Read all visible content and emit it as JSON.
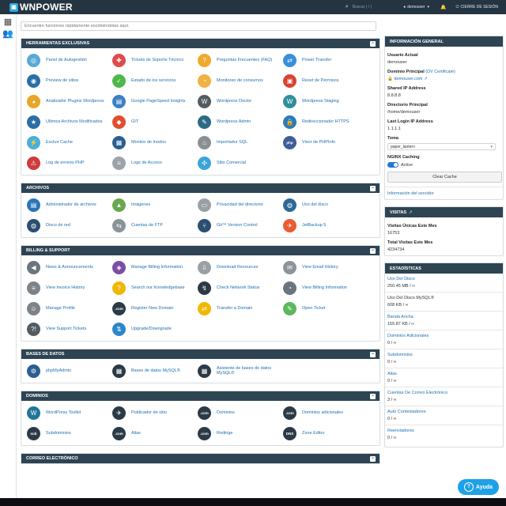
{
  "brand": {
    "name": "WNPOWER"
  },
  "topbar": {
    "search_placeholder": "Buscar ( / )",
    "user": "demouser",
    "logout": "CIERRE DE SESIÓN"
  },
  "main": {
    "search_placeholder": "Encuentre funciones rápidamente escribiéndolas aquí.",
    "panels": [
      {
        "title": "HERRAMIENTAS EXCLUSIVAS",
        "items": [
          {
            "label": "Panel de Autogestión",
            "icon": "dashboard-icon",
            "color": "#5ba9d6",
            "glyph": "◎"
          },
          {
            "label": "Tickets de Soporte Técnico",
            "icon": "lifebuoy-icon",
            "color": "#e04b4b",
            "glyph": "✚"
          },
          {
            "label": "Preguntas Frecuentes (FAQ)",
            "icon": "faq-icon",
            "color": "#f0a92b",
            "glyph": "?"
          },
          {
            "label": "Power Transfer",
            "icon": "power-transfer-icon",
            "color": "#3b8fd9",
            "glyph": "⇄"
          },
          {
            "label": "Preview de sitios",
            "icon": "eye-icon",
            "color": "#2b6fa6",
            "glyph": "◉"
          },
          {
            "label": "Estado de los servicios",
            "icon": "check-icon",
            "color": "#4fb848",
            "glyph": "✓"
          },
          {
            "label": "Monitoreo de consumos",
            "icon": "gauge-icon",
            "color": "#f0b243",
            "glyph": "◔"
          },
          {
            "label": "Reset de Permisos",
            "icon": "lock-icon",
            "color": "#d9442f",
            "glyph": "▣"
          },
          {
            "label": "Analizador Plugins Wordpress",
            "icon": "speedometer-icon",
            "color": "#e8a628",
            "glyph": "◕"
          },
          {
            "label": "Google PageSpeed Insights",
            "icon": "pagespeed-icon",
            "color": "#3d7fc4",
            "glyph": "▤"
          },
          {
            "label": "Wordpress Doctor",
            "icon": "wordpress-doctor-icon",
            "color": "#555b63",
            "glyph": "W"
          },
          {
            "label": "Wordpress Staging",
            "icon": "wordpress-staging-icon",
            "color": "#2f8f9d",
            "glyph": "W"
          },
          {
            "label": "Ultimos Archivos Modificados",
            "icon": "files-recent-icon",
            "color": "#2c6ea3",
            "glyph": "★"
          },
          {
            "label": "GIT",
            "icon": "git-icon",
            "color": "#e04e2f",
            "glyph": "◆"
          },
          {
            "label": "Wordpress Admin",
            "icon": "wordpress-admin-icon",
            "color": "#2e6a86",
            "glyph": "✎"
          },
          {
            "label": "Redireccionador HTTPS",
            "icon": "https-lock-icon",
            "color": "#2d7ab8",
            "glyph": "🔒"
          },
          {
            "label": "Excluir Cache",
            "icon": "cache-icon",
            "color": "#4ab0d9",
            "glyph": "⚡"
          },
          {
            "label": "Monitor de Inodos",
            "icon": "inode-monitor-icon",
            "color": "#2b5e92",
            "glyph": "▦"
          },
          {
            "label": "Importador SQL",
            "icon": "sql-import-icon",
            "color": "#8b8f94",
            "glyph": "⌂"
          },
          {
            "label": "Visor de PHPInfo",
            "icon": "php-icon",
            "color": "#3e5e99",
            "glyph": "php"
          },
          {
            "label": "Log de errores PHP",
            "icon": "error-log-icon",
            "color": "#d03b3b",
            "glyph": "⚠"
          },
          {
            "label": "Logs de Acceso",
            "icon": "access-log-icon",
            "color": "#9da3a8",
            "glyph": "≡"
          },
          {
            "label": "Sitio Comercial",
            "icon": "commercial-site-icon",
            "color": "#3ba5d9",
            "glyph": "✣"
          }
        ]
      },
      {
        "title": "ARCHIVOS",
        "items": [
          {
            "label": "Administrador de archivos",
            "icon": "file-manager-icon",
            "color": "#2c76b8",
            "glyph": "▤"
          },
          {
            "label": "Imágenes",
            "icon": "images-icon",
            "color": "#6aa84f",
            "glyph": "▲"
          },
          {
            "label": "Privacidad del directorio",
            "icon": "folder-privacy-icon",
            "color": "#9aa0a5",
            "glyph": "▭"
          },
          {
            "label": "Uso del disco",
            "icon": "disk-usage-icon",
            "color": "#2e6a96",
            "glyph": "◍"
          },
          {
            "label": "Disco de red",
            "icon": "network-disk-icon",
            "color": "#2b4f72",
            "glyph": "◍"
          },
          {
            "label": "Cuentas de FTP",
            "icon": "ftp-icon",
            "color": "#8c9399",
            "glyph": "⇆"
          },
          {
            "label": "Git™ Version Control",
            "icon": "git-version-icon",
            "color": "#2b4f72",
            "glyph": "⑂"
          },
          {
            "label": "JetBackup 5",
            "icon": "jetbackup-icon",
            "color": "#ea5b2f",
            "glyph": "✈"
          }
        ]
      },
      {
        "title": "BILLING & SUPPORT",
        "items": [
          {
            "label": "News & Announcements",
            "icon": "megaphone-icon",
            "color": "#6c757d",
            "glyph": "◀"
          },
          {
            "label": "Manage Billing Information",
            "icon": "billing-icon",
            "color": "#7a4fa3",
            "glyph": "◈"
          },
          {
            "label": "Download Resources",
            "icon": "download-icon",
            "color": "#9aa0a5",
            "glyph": "⇩"
          },
          {
            "label": "View Email History",
            "icon": "email-history-icon",
            "color": "#8c9399",
            "glyph": "✉"
          },
          {
            "label": "View Invoice History",
            "icon": "invoice-icon",
            "color": "#7d8389",
            "glyph": "≡"
          },
          {
            "label": "Search our Knowledgebase",
            "icon": "knowledgebase-icon",
            "color": "#f2b705",
            "glyph": "?"
          },
          {
            "label": "Check Network Status",
            "icon": "network-status-icon",
            "color": "#2b3a46",
            "glyph": "↯"
          },
          {
            "label": "View Billing Information",
            "icon": "view-billing-icon",
            "color": "#6c757d",
            "glyph": "◔"
          },
          {
            "label": "Manage Profile",
            "icon": "profile-icon",
            "color": "#7d8389",
            "glyph": "☺"
          },
          {
            "label": "Register New Domain",
            "icon": "register-domain-icon",
            "color": "#2b3a46",
            "glyph": ".com"
          },
          {
            "label": "Transfer a Domain",
            "icon": "transfer-domain-icon",
            "color": "#f2b705",
            "glyph": "⇄"
          },
          {
            "label": "Open Ticket",
            "icon": "ticket-icon",
            "color": "#5cb85c",
            "glyph": "✎"
          },
          {
            "label": "View Support Tickets",
            "icon": "support-tickets-icon",
            "color": "#555b63",
            "glyph": "?!"
          },
          {
            "label": "Upgrade/Downgrade",
            "icon": "upgrade-icon",
            "color": "#2a87c9",
            "glyph": "⇅"
          }
        ]
      },
      {
        "title": "BASES DE DATOS",
        "items": [
          {
            "label": "phpMyAdmin",
            "icon": "phpmyadmin-icon",
            "color": "#2b5e92",
            "glyph": "⚙"
          },
          {
            "label": "Bases de datos MySQL®",
            "icon": "mysql-icon",
            "color": "#2b3a46",
            "glyph": "▦"
          },
          {
            "label": "Asistente de bases de datos MySQL®",
            "icon": "mysql-wizard-icon",
            "color": "#2b3a46",
            "glyph": "▦"
          }
        ]
      },
      {
        "title": "DOMINIOS",
        "items": [
          {
            "label": "WordPress Toolkit",
            "icon": "wordpress-toolkit-icon",
            "color": "#21759b",
            "glyph": "W"
          },
          {
            "label": "Publicador de sitio",
            "icon": "site-publisher-icon",
            "color": "#2b3a46",
            "glyph": "✈"
          },
          {
            "label": "Dominios",
            "icon": "domains-icon",
            "color": "#2b3a46",
            "glyph": ".com"
          },
          {
            "label": "Dominios adicionales",
            "icon": "addon-domains-icon",
            "color": "#2b3a46",
            "glyph": ".com"
          },
          {
            "label": "Subdominios",
            "icon": "subdomains-icon",
            "color": "#2b3a46",
            "glyph": "sub"
          },
          {
            "label": "Alias",
            "icon": "alias-icon",
            "color": "#2b3a46",
            "glyph": ".com"
          },
          {
            "label": "Redirige",
            "icon": "redirect-icon",
            "color": "#2b3a46",
            "glyph": ".com"
          },
          {
            "label": "Zone Editor",
            "icon": "zone-editor-icon",
            "color": "#2b3a46",
            "glyph": "DNS"
          }
        ]
      },
      {
        "title": "CORREO ELECTRÓNICO",
        "items": []
      }
    ]
  },
  "general_info": {
    "title": "INFORMACIÓN GENERAL",
    "current_user_label": "Usuario Actual",
    "current_user": "demouser",
    "main_domain_label": "Dominio Principal",
    "ssl_badge": "(DV Certificate)",
    "main_domain": "demouser.com",
    "shared_ip_label": "Shared IP Address",
    "shared_ip": "8.8.8.8",
    "home_dir_label": "Directorio Principal",
    "home_dir": "/home/demouser",
    "last_login_label": "Last Login IP Address",
    "last_login": "1.1.1.1",
    "theme_label": "Tema",
    "theme_value": "paper_lantern",
    "nginx_label": "NGINX Caching",
    "nginx_state": "Active",
    "clear_cache": "Clear Cache",
    "server_info": "Información del servidor"
  },
  "visits": {
    "title": "VISITAS",
    "unique_label": "Visitas Únicas Este Mes",
    "unique_value": "16753",
    "total_label": "Total Visitas Este Mes",
    "total_value": "4234734"
  },
  "stats": {
    "title": "ESTADÍSTICAS",
    "rows": [
      {
        "name": "Uso Del Disco",
        "value": "250.45 MB / ∞",
        "link": true
      },
      {
        "name": "Uso Del Disco MySQL®",
        "value": "608 KB / ∞",
        "link": false
      },
      {
        "name": "Banda Ancha",
        "value": "155.87 KB / ∞",
        "link": true
      },
      {
        "name": "Dominios Adicionales",
        "value": "0 / ∞",
        "link": true
      },
      {
        "name": "Subdominios",
        "value": "0 / ∞",
        "link": true
      },
      {
        "name": "Alias",
        "value": "0 / ∞",
        "link": true
      },
      {
        "name": "Cuentas De Correo Electrónico",
        "value": "3 / ∞",
        "link": true
      },
      {
        "name": "Auto Contestadores",
        "value": "0 / ∞",
        "link": true
      },
      {
        "name": "Reenviadores",
        "value": "0 / ∞",
        "link": true
      }
    ]
  },
  "help": {
    "label": "Ayuda"
  }
}
